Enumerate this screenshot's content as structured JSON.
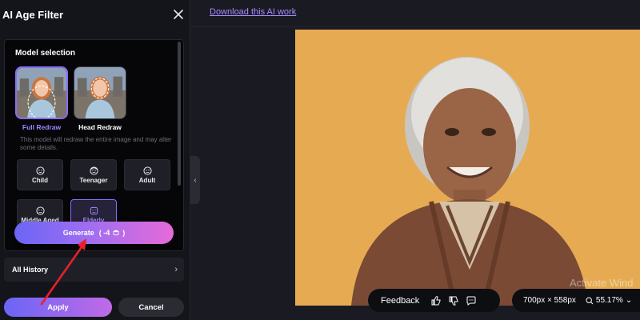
{
  "panel": {
    "title": "AI Age Filter",
    "model_selection": {
      "title": "Model selection",
      "options": [
        {
          "label": "Full Redraw",
          "selected": true
        },
        {
          "label": "Head Redraw",
          "selected": false
        }
      ],
      "description": "This model will redraw the entire image and may alter some details."
    },
    "age_options": [
      {
        "label": "Child",
        "icon": "child-face-icon"
      },
      {
        "label": "Teenager",
        "icon": "teen-face-icon"
      },
      {
        "label": "Adult",
        "icon": "adult-face-icon"
      },
      {
        "label": "Middle Aged",
        "icon": "middle-aged-face-icon"
      },
      {
        "label": "Elderly",
        "icon": "elderly-face-icon",
        "selected": true
      }
    ],
    "generate": {
      "label": "Generate",
      "cost": "( -4",
      "close": ")"
    },
    "history": {
      "label": "All History"
    },
    "apply_label": "Apply",
    "cancel_label": "Cancel"
  },
  "main": {
    "download_link": "Download this AI work",
    "feedback_label": "Feedback",
    "image_size": "700px × 558px",
    "zoom": "55.17%",
    "watermark": "Activate Wind"
  },
  "colors": {
    "accent": "#8a6cf6",
    "gradient_start": "#6a66f6",
    "gradient_end": "#e66ad8",
    "annotation_arrow": "#e8202a",
    "photo_background": "#e6ab52"
  }
}
